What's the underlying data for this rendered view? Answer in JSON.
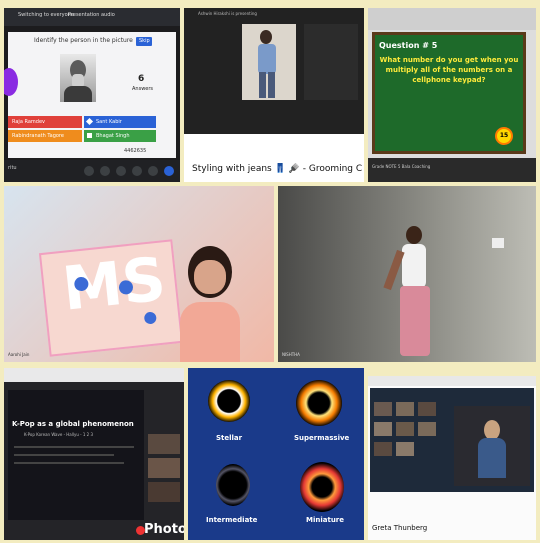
{
  "quiz": {
    "top_tabs": [
      "Switching to everyone",
      "Presentation audio"
    ],
    "question": "Identify the person in the picture",
    "button": "Skip",
    "answer_count": "6",
    "answer_label": "Answers",
    "options": [
      "Raja Ramdev",
      "Sant Kabir",
      "Rabindranath Tagore",
      "Bhagat Singh"
    ],
    "meeting_user": "ritu",
    "meeting_code": "4462635",
    "colors": {
      "red": "#e0403a",
      "blue": "#2a62d6",
      "orange": "#ef8c1d",
      "green": "#3aa046"
    }
  },
  "grooming": {
    "top_label": "Ashwin Hirakshi is presenting",
    "caption": "Styling with jeans 👖 🪮 - Grooming C"
  },
  "question_slide": {
    "title": "Question # 5",
    "text": "What number do you get when you multiply all of the numbers on a cellphone keypad?",
    "timer": "15",
    "footer": "Grade NOTE 5 Bala Coaching"
  },
  "art": {
    "name_label": "Aarohi Jain"
  },
  "dance": {
    "name_label": "NISHTHA"
  },
  "kpop": {
    "title": "K-Pop as a global phenomenon",
    "subtitle": "K-Pop Korean Wave - Hallyu - 1 2 3"
  },
  "blackholes": {
    "labels": [
      "Stellar",
      "Supermassive",
      "Intermediate",
      "Miniature"
    ]
  },
  "greta": {
    "name": "Greta Thunberg"
  },
  "watermark": "PhotoGrid"
}
